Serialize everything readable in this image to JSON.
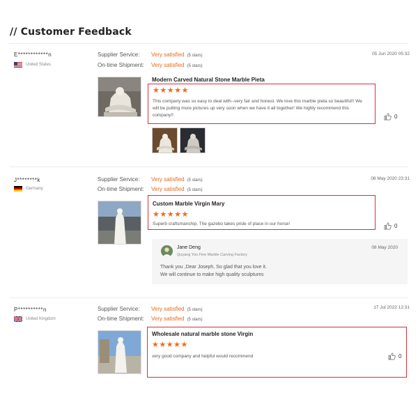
{
  "page": {
    "title": "// Customer Feedback"
  },
  "labels": {
    "supplier_service": "Supplier Service:",
    "ontime_shipment": "On-time Shipment:"
  },
  "colors": {
    "accent": "#e8681a",
    "highlight_border": "#d9303a",
    "stars": "#f26a1b"
  },
  "reviews": [
    {
      "reviewer": "E************n",
      "country": "United States",
      "flag_icon": "us-flag-icon",
      "supplier_service": "Very satisfied",
      "supplier_service_stars": "(5 stars)",
      "ontime_shipment": "Very satisfied",
      "ontime_shipment_stars": "(5 stars)",
      "date": "05 Jun 2020 05:32",
      "product_title": "Modern Carved Natural Stone Marble Pieta",
      "rating": 5,
      "stars": "★★★★★",
      "text": "This company was so easy to deal with--very fair and honest.  We love this marble pieta so beautiful!!  We will be putting more pictures up very soon when we have it all together!  We highly recommend this company!!",
      "likes": "0"
    },
    {
      "reviewer": "J********k",
      "country": "Germany",
      "flag_icon": "germany-flag-icon",
      "supplier_service": "Very satisfied",
      "supplier_service_stars": "(5 stars)",
      "ontime_shipment": "Very satisfied",
      "ontime_shipment_stars": "(5 stars)",
      "date": "08 May 2020 23:31",
      "product_title": "Custom Marble Virgin Mary",
      "rating": 5,
      "stars": "★★★★★",
      "text": "Superb craftsmanship. The gazebo takes pride of place in our horse!",
      "likes": "0",
      "reply": {
        "name": "Jane Deng",
        "company": "Quyang You Fine Marble Carving Factory",
        "date": "08 May 2020",
        "line1": "Thank you ,Dear Joseph, So glad that you love it.",
        "line2": "We will continue to make high quality sculptures"
      }
    },
    {
      "reviewer": "P**********n",
      "country": "United Kingdom",
      "flag_icon": "uk-flag-icon",
      "supplier_service": "Very satisfied",
      "supplier_service_stars": "(5 stars)",
      "ontime_shipment": "Very satisfied",
      "ontime_shipment_stars": "(5 stars)",
      "date": "17 Jul 2022 12:31",
      "product_title": "Wholesale natural marble stone Virgin",
      "rating": 5,
      "stars": "★★★★★",
      "text": "very good company and helpful would recommend",
      "likes": "0"
    }
  ]
}
